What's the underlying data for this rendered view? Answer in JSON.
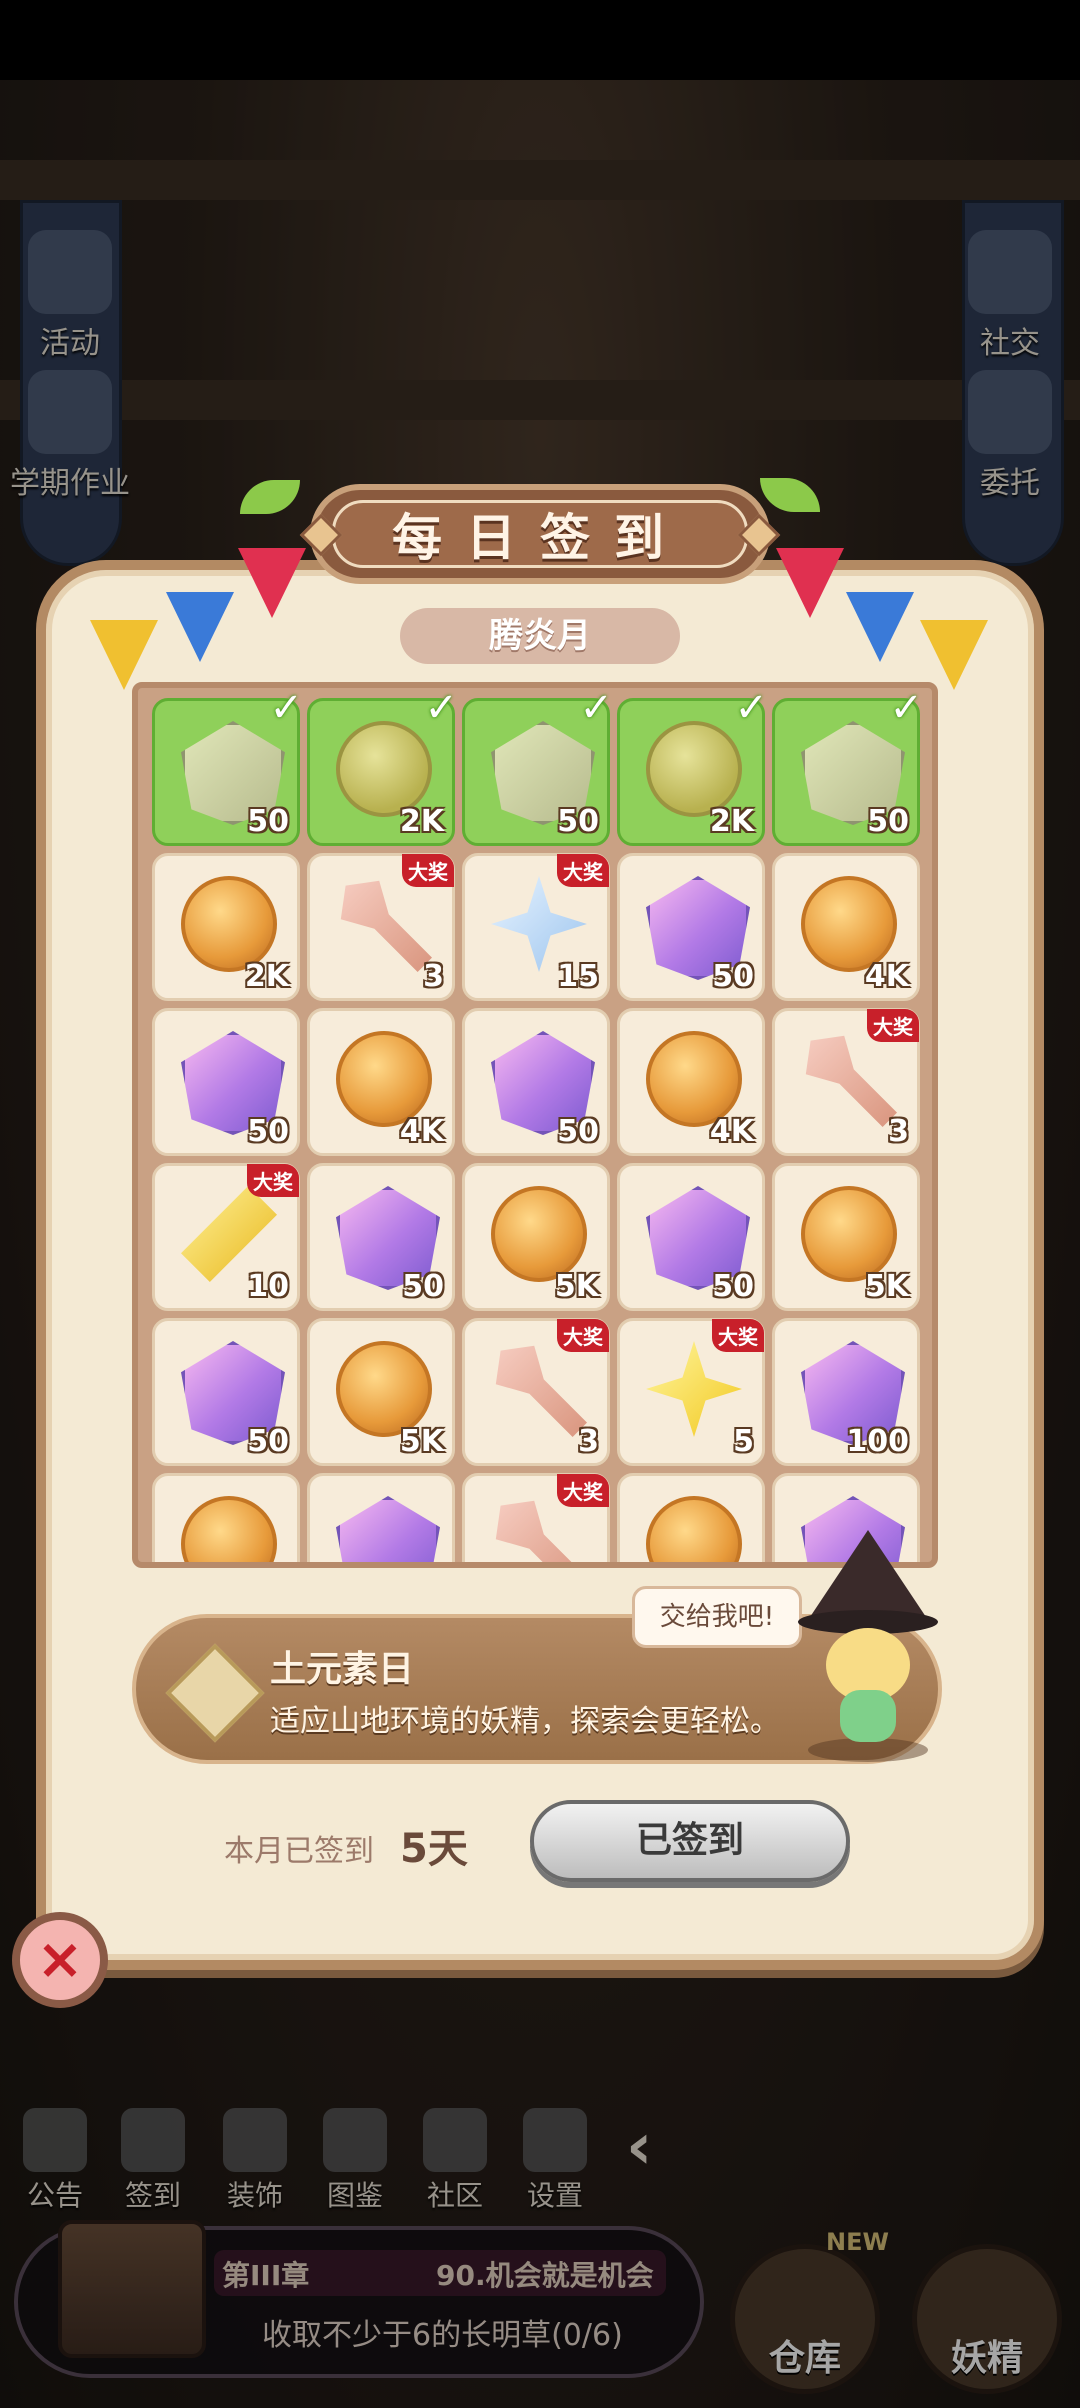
{
  "left_menu": [
    {
      "label": "活动",
      "icon": "event-icon"
    },
    {
      "label": "学期作业",
      "icon": "homework-icon"
    }
  ],
  "right_menu": [
    {
      "label": "社交",
      "icon": "social-icon"
    },
    {
      "label": "委托",
      "icon": "commission-icon"
    }
  ],
  "dialog": {
    "title": "每日签到",
    "month": "腾炎月",
    "cells": [
      {
        "item": "gem-dim",
        "count": "50",
        "claimed": true,
        "grand": false
      },
      {
        "item": "coin-dim",
        "count": "2K",
        "claimed": true,
        "grand": false
      },
      {
        "item": "gem-dim",
        "count": "50",
        "claimed": true,
        "grand": false
      },
      {
        "item": "coin-dim",
        "count": "2K",
        "claimed": true,
        "grand": false
      },
      {
        "item": "gem-dim",
        "count": "50",
        "claimed": true,
        "grand": false
      },
      {
        "item": "coin",
        "count": "2K",
        "claimed": false,
        "grand": false
      },
      {
        "item": "key",
        "count": "3",
        "claimed": false,
        "grand": true
      },
      {
        "item": "star-blue",
        "count": "15",
        "claimed": false,
        "grand": true
      },
      {
        "item": "gem",
        "count": "50",
        "claimed": false,
        "grand": false
      },
      {
        "item": "coin",
        "count": "4K",
        "claimed": false,
        "grand": false
      },
      {
        "item": "gem",
        "count": "50",
        "claimed": false,
        "grand": false
      },
      {
        "item": "coin",
        "count": "4K",
        "claimed": false,
        "grand": false
      },
      {
        "item": "gem",
        "count": "50",
        "claimed": false,
        "grand": false
      },
      {
        "item": "coin",
        "count": "4K",
        "claimed": false,
        "grand": false
      },
      {
        "item": "key",
        "count": "3",
        "claimed": false,
        "grand": true
      },
      {
        "item": "shard-yellow",
        "count": "10",
        "claimed": false,
        "grand": true
      },
      {
        "item": "gem",
        "count": "50",
        "claimed": false,
        "grand": false
      },
      {
        "item": "coin",
        "count": "5K",
        "claimed": false,
        "grand": false
      },
      {
        "item": "gem",
        "count": "50",
        "claimed": false,
        "grand": false
      },
      {
        "item": "coin",
        "count": "5K",
        "claimed": false,
        "grand": false
      },
      {
        "item": "gem",
        "count": "50",
        "claimed": false,
        "grand": false
      },
      {
        "item": "coin",
        "count": "5K",
        "claimed": false,
        "grand": false
      },
      {
        "item": "key",
        "count": "3",
        "claimed": false,
        "grand": true
      },
      {
        "item": "star-yellow",
        "count": "5",
        "claimed": false,
        "grand": true
      },
      {
        "item": "gem",
        "count": "100",
        "claimed": false,
        "grand": false
      },
      {
        "item": "coin",
        "count": "",
        "claimed": false,
        "grand": false
      },
      {
        "item": "gem",
        "count": "",
        "claimed": false,
        "grand": false
      },
      {
        "item": "key",
        "count": "",
        "claimed": false,
        "grand": true
      },
      {
        "item": "coin",
        "count": "",
        "claimed": false,
        "grand": false
      },
      {
        "item": "gem",
        "count": "",
        "claimed": false,
        "grand": false
      }
    ],
    "grand_label": "大奖",
    "check": "✓",
    "bubble": "交给我吧!",
    "day_name": "土元素日",
    "day_desc": "适应山地环境的妖精，探索会更轻松。",
    "signed_label": "本月已签到",
    "signed_days": "5天",
    "signin_button": "已签到",
    "close": "×"
  },
  "bottom_menu": [
    {
      "label": "公告",
      "icon": "notice-icon"
    },
    {
      "label": "签到",
      "icon": "calendar-icon"
    },
    {
      "label": "装饰",
      "icon": "decor-icon"
    },
    {
      "label": "图鉴",
      "icon": "book-icon"
    },
    {
      "label": "社区",
      "icon": "home-icon"
    },
    {
      "label": "设置",
      "icon": "gear-icon"
    }
  ],
  "collapse_arrow": "‹",
  "quest": {
    "chapter": "第III章",
    "chapter_title": "90.机会就是机会",
    "task": "收取不少于6的长明草(0/6)"
  },
  "warehouse_label": "仓库",
  "fairy_label": "妖精",
  "new_tag": "NEW",
  "colors": {
    "claimed_green": "#8fd05a",
    "grand_red": "#c8202a",
    "panel_cream": "#f4ead4",
    "frame_brown": "#b38a63"
  }
}
